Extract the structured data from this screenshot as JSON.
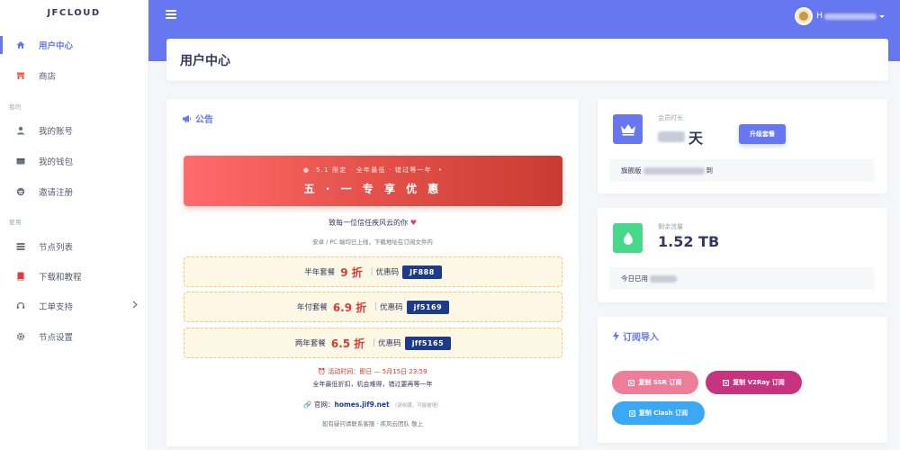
{
  "brand": "JFCLOUD",
  "sidebar": {
    "items": [
      {
        "label": "用户中心",
        "icon": "home-icon",
        "active": true
      },
      {
        "label": "商店",
        "icon": "store-icon"
      }
    ],
    "section_mine": "我的",
    "mine_items": [
      {
        "label": "我的账号",
        "icon": "user-icon"
      },
      {
        "label": "我的钱包",
        "icon": "wallet-icon"
      },
      {
        "label": "邀请注册",
        "icon": "invite-icon"
      }
    ],
    "section_use": "使用",
    "use_items": [
      {
        "label": "节点列表",
        "icon": "list-icon"
      },
      {
        "label": "下载和教程",
        "icon": "book-icon"
      },
      {
        "label": "工单支持",
        "icon": "headset-icon",
        "has_submenu": true
      },
      {
        "label": "节点设置",
        "icon": "cog-icon"
      }
    ]
  },
  "topbar": {
    "username_visible": "H"
  },
  "page_title": "用户中心",
  "announcement": {
    "heading": "公告",
    "promo_sub": "5.1 限定 · 全年最低 · 错过等一年",
    "promo_main": "五 · 一 专 享 优 惠",
    "thanks": "致每一位信任疾风云的你",
    "platform": "安卓 / PC 端均已上线，下载地址在订阅文件内",
    "coupons": [
      {
        "plan": "半年套餐",
        "discount": "9 折",
        "code_label": "优惠码",
        "code": "JF888"
      },
      {
        "plan": "年付套餐",
        "discount": "6.9 折",
        "code_label": "优惠码",
        "code": "jf5169"
      },
      {
        "plan": "两年套餐",
        "discount": "6.5 折",
        "code_label": "优惠码",
        "code": "jff5165"
      }
    ],
    "activity_time": "活动时间：即日 — 5月15日 23:59",
    "activity_sub": "全年最低折扣，机会难得，错过要再等一年",
    "website_label": "官网：",
    "website_url": "homes.jif9.net",
    "website_hint": "（请收藏，可能被墙）",
    "footer": "如有疑问请联系客服 · 疾风云团队 敬上"
  },
  "membership": {
    "label": "会员时长",
    "unit": "天",
    "upgrade_button": "升级套餐",
    "plan_prefix": "旗舰版",
    "plan_suffix": "到"
  },
  "traffic": {
    "label": "剩余流量",
    "value": "1.52 TB",
    "today_prefix": "今日已用"
  },
  "subscription": {
    "heading": "订阅导入",
    "ssr_button": "复制 SSR 订阅",
    "v2ray_button": "复制 V2Ray 订阅",
    "clash_button": "复制 Clash 订阅"
  },
  "colors": {
    "primary": "#6777ef",
    "promo_red": "#e4514a",
    "code_blue": "#1e3a8a",
    "ssr_pink": "#ee7d9a",
    "v2ray_magenta": "#c7337f",
    "clash_blue": "#3aa8f5",
    "traffic_green": "#47d88a"
  }
}
